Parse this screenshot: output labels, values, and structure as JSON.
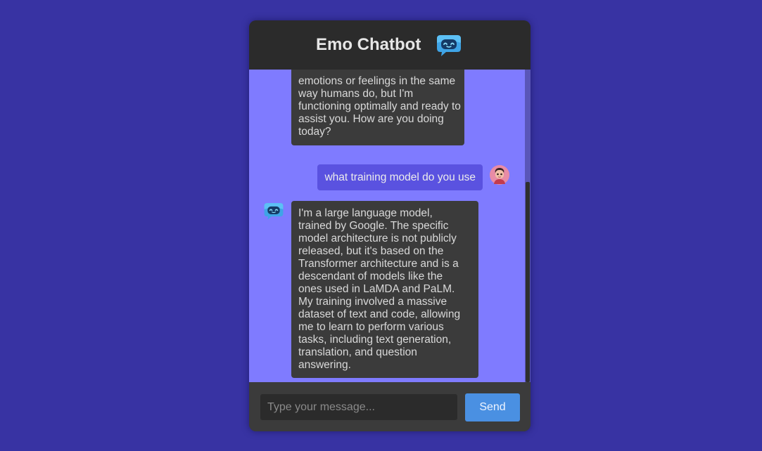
{
  "header": {
    "title": "Emo Chatbot",
    "icon": "robot-chat-icon"
  },
  "messages": [
    {
      "sender": "bot",
      "text": "emotions or feelings in the same\nway humans do, but I'm\nfunctioning optimally and ready to\nassist you. How are you doing\ntoday?"
    },
    {
      "sender": "user",
      "text": "what training model do you use"
    },
    {
      "sender": "bot",
      "text": "I'm a large language model,\ntrained by Google. The specific\nmodel architecture is not publicly\nreleased, but it's based on the\nTransformer architecture and is a\ndescendant of models like the\nones used in LaMDA and PaLM.\nMy training involved a massive\ndataset of text and code, allowing\nme to learn to perform various\ntasks, including text generation,\ntranslation, and question\nanswering."
    }
  ],
  "composer": {
    "placeholder": "Type your message...",
    "value": "",
    "send_label": "Send"
  },
  "colors": {
    "page_background": "#3833a3",
    "chat_background": "#7f7bff",
    "header_background": "#2b2b2b",
    "bot_bubble": "#3b3b3b",
    "user_bubble": "#5a52e0",
    "send_button": "#4a90e2"
  }
}
